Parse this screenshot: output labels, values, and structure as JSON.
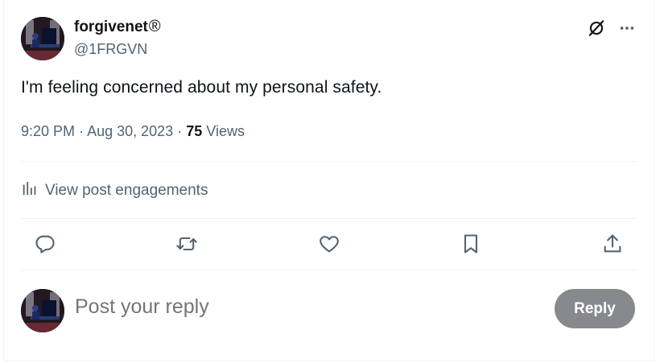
{
  "post": {
    "author": {
      "display_name": "forgivenet",
      "badge": "®",
      "handle": "@1FRGVN"
    },
    "text": "I'm feeling concerned about my personal safety.",
    "time": "9:20 PM",
    "separator": "·",
    "date": "Aug 30, 2023",
    "views_count": "75",
    "views_label": "Views"
  },
  "engagements_link": "View post engagements",
  "icons": {
    "header": [
      "grok-icon",
      "more-icon"
    ],
    "actions": [
      "reply-icon",
      "repost-icon",
      "like-icon",
      "bookmark-icon",
      "share-icon"
    ],
    "engagements": "analytics-bars-icon"
  },
  "reply_box": {
    "placeholder": "Post your reply",
    "button_label": "Reply"
  },
  "colors": {
    "text_primary": "#0f1419",
    "text_secondary": "#536471",
    "divider": "#eff3f4",
    "reply_button_disabled": "#87898c"
  }
}
